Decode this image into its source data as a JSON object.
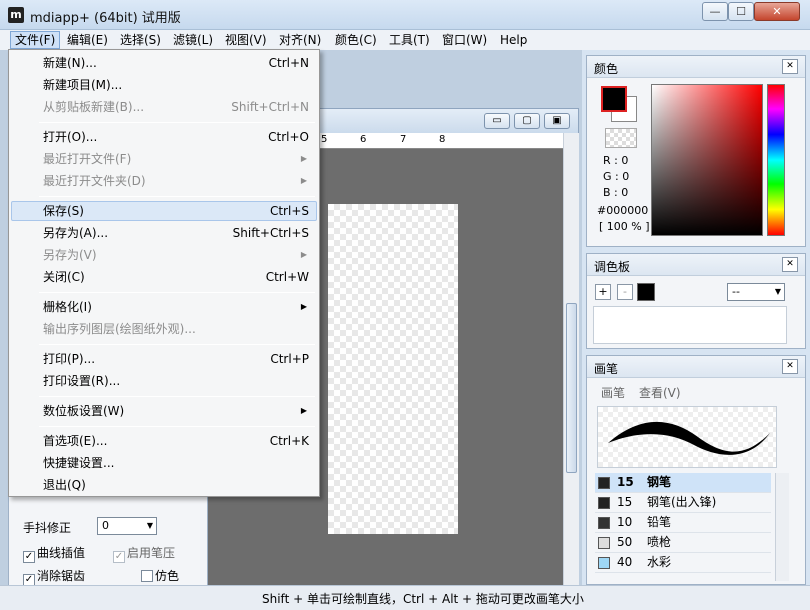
{
  "window": {
    "title": "mdiapp+ (64bit) 试用版",
    "app_icon": "m",
    "controls": {
      "minimize": "—",
      "maximize": "☐",
      "close": "✕"
    }
  },
  "menubar": [
    {
      "label": "文件(F)"
    },
    {
      "label": "编辑(E)"
    },
    {
      "label": "选择(S)"
    },
    {
      "label": "滤镜(L)"
    },
    {
      "label": "视图(V)"
    },
    {
      "label": "对齐(N)"
    },
    {
      "label": "颜色(C)"
    },
    {
      "label": "工具(T)"
    },
    {
      "label": "窗口(W)"
    },
    {
      "label": "Help"
    }
  ],
  "file_menu": [
    {
      "label": "新建(N)...",
      "shortcut": "Ctrl+N"
    },
    {
      "label": "新建项目(M)...",
      "shortcut": ""
    },
    {
      "label": "从剪贴板新建(B)...",
      "shortcut": "Shift+Ctrl+N"
    },
    {
      "label": "打开(O)...",
      "shortcut": "Ctrl+O"
    },
    {
      "label": "最近打开文件(F)",
      "shortcut": ""
    },
    {
      "label": "最近打开文件夹(D)",
      "shortcut": ""
    },
    {
      "label": "保存(S)",
      "shortcut": "Ctrl+S"
    },
    {
      "label": "另存为(A)...",
      "shortcut": "Shift+Ctrl+S"
    },
    {
      "label": "另存为(V)",
      "shortcut": ""
    },
    {
      "label": "关闭(C)",
      "shortcut": "Ctrl+W"
    },
    {
      "label": "栅格化(I)",
      "shortcut": ""
    },
    {
      "label": "输出序列图层(绘图纸外观)...",
      "shortcut": ""
    },
    {
      "label": "打印(P)...",
      "shortcut": "Ctrl+P"
    },
    {
      "label": "打印设置(R)...",
      "shortcut": ""
    },
    {
      "label": "数位板设置(W)",
      "shortcut": ""
    },
    {
      "label": "首选项(E)...",
      "shortcut": "Ctrl+K"
    },
    {
      "label": "快捷键设置...",
      "shortcut": ""
    },
    {
      "label": "退出(Q)",
      "shortcut": ""
    }
  ],
  "submenu_arrow": "▶",
  "ruler": [
    "5",
    "6",
    "7",
    "8"
  ],
  "doc_controls": {
    "minimize": "▭",
    "maximize": "▢",
    "close": "▣"
  },
  "hscroll_grip": "|||",
  "tool_panel": {
    "stabilizer_label": "手抖修正",
    "stabilizer_value": "0",
    "curve_interp": "曲线插值",
    "pen_pressure": "启用笔压",
    "antialias": "消除锯齿",
    "fake": "仿色",
    "check": "✓"
  },
  "color_panel": {
    "title": "颜色",
    "r": "R : 0",
    "g": "G : 0",
    "b": "B : 0",
    "hex": "#000000",
    "opacity": "[ 100 % ]",
    "close": "✕"
  },
  "palette_panel": {
    "title": "调色板",
    "add": "+",
    "remove": "-",
    "select_value": "--",
    "close": "✕"
  },
  "brush_panel": {
    "title": "画笔",
    "tab_brush": "画笔",
    "tab_view": "查看(V)",
    "close": "✕",
    "items": [
      {
        "size": "15",
        "name": "钢笔",
        "color": "#222222"
      },
      {
        "size": "15",
        "name": "钢笔(出入锋)",
        "color": "#222222"
      },
      {
        "size": "10",
        "name": "铅笔",
        "color": "#333333"
      },
      {
        "size": "50",
        "name": "喷枪",
        "color": "#dddddd"
      },
      {
        "size": "40",
        "name": "水彩",
        "color": "#9fd7f5"
      }
    ]
  },
  "status": "Shift + 单击可绘制直线，Ctrl + Alt + 拖动可更改画笔大小"
}
